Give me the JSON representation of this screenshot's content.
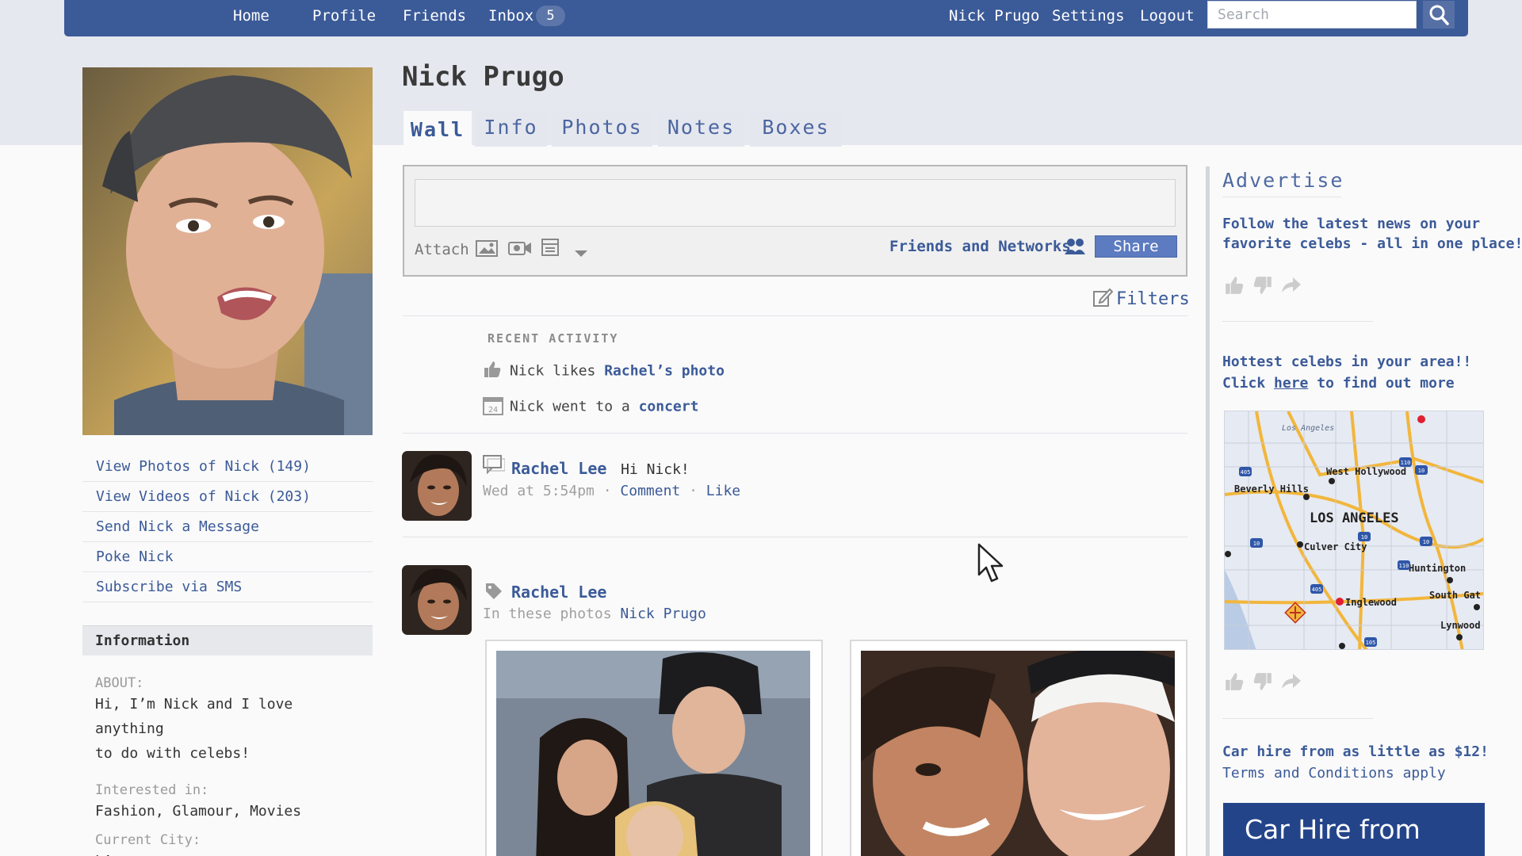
{
  "nav": {
    "home": "Home",
    "profile": "Profile",
    "friends": "Friends",
    "inbox": "Inbox",
    "inbox_count": "5",
    "user": "Nick Prugo",
    "settings": "Settings",
    "logout": "Logout",
    "search_placeholder": "Search"
  },
  "profile": {
    "name": "Nick Prugo",
    "tabs": [
      "Wall",
      "Info",
      "Photos",
      "Notes",
      "Boxes"
    ],
    "active_tab": "Wall"
  },
  "left_links": [
    "View Photos of Nick (149)",
    "View Videos of Nick (203)",
    "Send Nick a Message",
    "Poke Nick",
    "Subscribe via SMS"
  ],
  "information": {
    "heading": "Information",
    "about_label": "ABOUT:",
    "about_line1": "Hi, I’m Nick and I love anything",
    "about_line2": "to do with celebs!",
    "interested_label": "Interested in:",
    "interested_value": "Fashion, Glamour, Movies",
    "city_label": "Current City:",
    "city_value": "LA"
  },
  "composer": {
    "attach_label": "Attach",
    "privacy": "Friends and Networks",
    "share": "Share"
  },
  "feed": {
    "filters": "Filters",
    "recent_title": "RECENT ACTIVITY",
    "activity1_text": "Nick likes ",
    "activity1_link": "Rachel’s photo",
    "activity2_text": "Nick went to a ",
    "activity2_link": "concert",
    "activity2_day": "24",
    "post1_author": "Rachel Lee",
    "post1_text": "Hi Nick!",
    "post1_time": "Wed at 5:54pm",
    "post1_comment": "Comment",
    "post1_like": "Like",
    "post2_author": "Rachel Lee",
    "post2_meta": "In these photos",
    "post2_tag": "Nick Prugo"
  },
  "ads": {
    "title": "Advertise",
    "ad1_line1": "Follow the latest news on your",
    "ad1_line2": "favorite celebs - all in one place!",
    "ad2_line1": "Hottest celebs in your area!!",
    "ad2_click": "Click ",
    "ad2_here": "here",
    "ad2_rest": " to find out more",
    "map_labels": [
      "Los Angeles",
      "West Hollywood",
      "Beverly Hills",
      "LOS ANGELES",
      "Culver City",
      "Huntington",
      "South Gat",
      "Inglewood",
      "Lynwood"
    ],
    "map_shields": [
      "405",
      "10",
      "10",
      "10",
      "110",
      "405",
      "105",
      "110",
      "10"
    ],
    "ad3_line1": "Car hire from as little as $12!",
    "ad3_line2": "Terms and Conditions apply",
    "banner": "Car Hire from"
  },
  "colors": {
    "brand": "#3b5a98",
    "link": "#3b5a98",
    "share_button": "#5c7bc0"
  }
}
